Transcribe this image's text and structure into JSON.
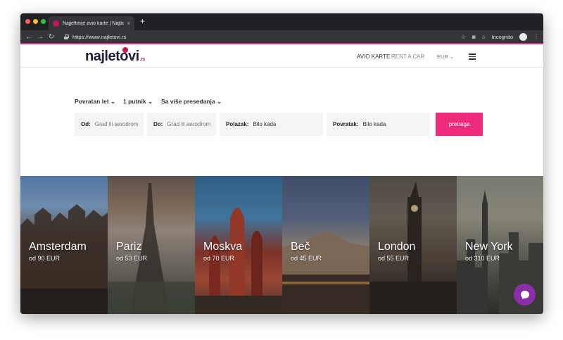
{
  "browser": {
    "tab_title": "Najjeftinije avio karte | Najbolj...",
    "tab_close": "×",
    "new_tab": "+",
    "url": "https://www.najletovi.rs",
    "mode": "Incognito",
    "icons": [
      "back-icon",
      "forward-icon",
      "reload-icon",
      "lock-icon",
      "star-icon",
      "camera-icon",
      "extension-icon",
      "incognito-icon",
      "menu-dots-icon"
    ]
  },
  "header": {
    "logo_text": "najletovi",
    "logo_suffix": ".rs",
    "nav": {
      "avio": "AVIO KARTE",
      "rent": "RENT A CAR"
    },
    "currency": "EUR"
  },
  "search": {
    "options": [
      "Povratan let",
      "1 putnik",
      "Sa više presedanja"
    ],
    "fields": {
      "od": {
        "label": "Od:",
        "placeholder": "Grad ili aerodrom"
      },
      "do": {
        "label": "Do:",
        "placeholder": "Grad ili aerodrom"
      },
      "polazak": {
        "label": "Polazak:",
        "value": "Bilo kada"
      },
      "povratak": {
        "label": "Povratak:",
        "value": "Bilo kada"
      }
    },
    "button": "pretraga"
  },
  "destinations": [
    {
      "city": "Amsterdam",
      "price": "od 90 EUR"
    },
    {
      "city": "Pariz",
      "price": "od 53 EUR"
    },
    {
      "city": "Moskva",
      "price": "od 70 EUR"
    },
    {
      "city": "Beč",
      "price": "od 45 EUR"
    },
    {
      "city": "London",
      "price": "od 55 EUR"
    },
    {
      "city": "New York",
      "price": "od 310 EUR"
    }
  ],
  "colors": {
    "accent": "#ee2a7b",
    "brand": "#c2185b",
    "chat": "#8b2fa8"
  }
}
